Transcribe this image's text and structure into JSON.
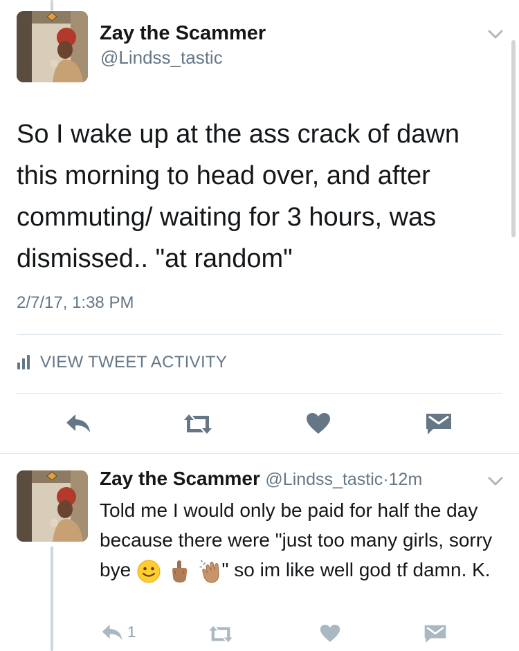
{
  "main_tweet": {
    "author_name": "Zay the Scammer",
    "author_handle": "@Lindss_tastic",
    "text": "So I wake up at the ass crack of dawn this morning to head over, and after commuting/ waiting for 3 hours, was dismissed.. \"at random\"",
    "timestamp": "2/7/17, 1:38 PM",
    "activity_label": "VIEW TWEET ACTIVITY"
  },
  "reply_tweet": {
    "author_name": "Zay the Scammer",
    "author_handle": "@Lindss_tastic",
    "separator": "·",
    "age": "12m",
    "text_before_emoji": "Told me I would only be paid for half the day because there were \"just too many girls, sorry bye ",
    "text_after_emoji": "\" so im like well god tf damn. K.",
    "reply_count": "1"
  },
  "icons": [
    "chevron-down-icon",
    "bar-chart-icon",
    "reply-icon",
    "retweet-icon",
    "heart-icon",
    "direct-message-icon",
    "slightly-smiling-face-emoji",
    "middle-finger-emoji",
    "waving-hand-emoji"
  ],
  "colors": {
    "text": "#14171a",
    "secondary": "#657786",
    "icon": "#657786",
    "divider": "#e1e8ed",
    "thread_line": "#ccd6dd"
  }
}
